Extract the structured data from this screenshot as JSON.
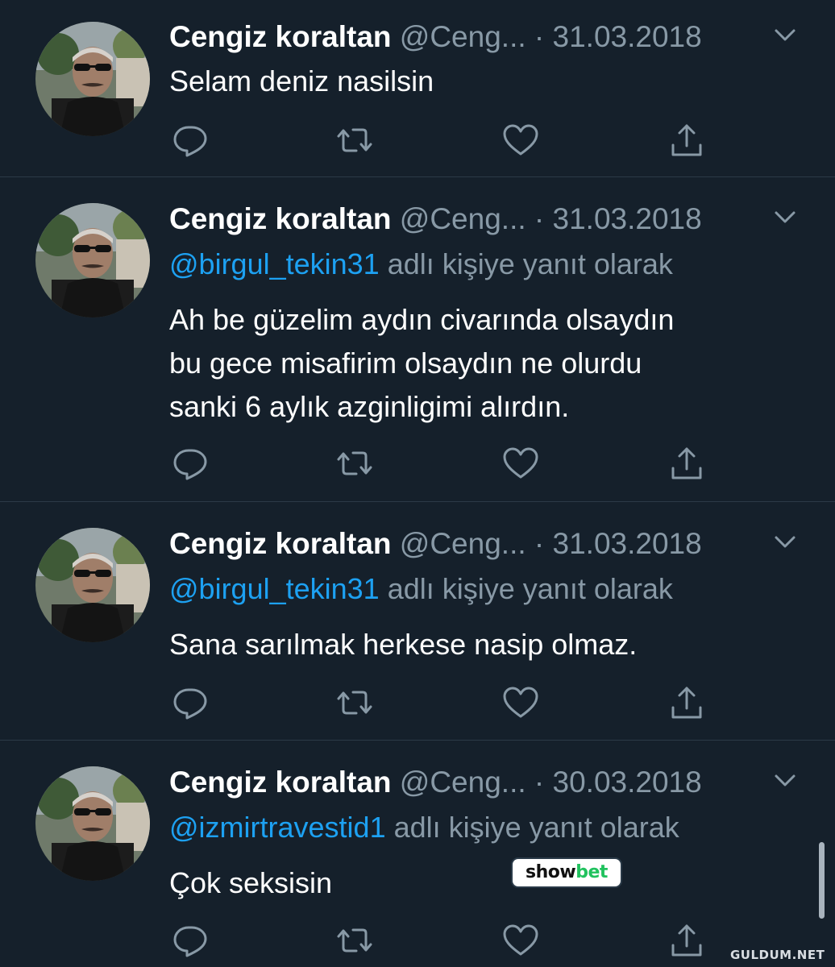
{
  "theme": {
    "background": "#15202b",
    "name_color": "#ffffff",
    "muted_color": "#8899a6",
    "link_color": "#1da1f2",
    "divider_color": "#2c3a47"
  },
  "tweets": [
    {
      "name": "Cengiz koraltan",
      "handle": "@Ceng...",
      "separator": "·",
      "date": "31.03.2018",
      "reply_to": "",
      "reply_suffix": "",
      "text": "Selam deniz nasilsin"
    },
    {
      "name": "Cengiz koraltan",
      "handle": "@Ceng...",
      "separator": "·",
      "date": "31.03.2018",
      "reply_to": "@birgul_tekin31",
      "reply_suffix": "adlı kişiye yanıt olarak",
      "text": "Ah be güzelim aydın civarında olsaydın\nbu gece misafirim olsaydın ne olurdu\nsanki 6 aylık azginligimi alırdın."
    },
    {
      "name": "Cengiz koraltan",
      "handle": "@Ceng...",
      "separator": "·",
      "date": "31.03.2018",
      "reply_to": "@birgul_tekin31",
      "reply_suffix": "adlı kişiye yanıt olarak",
      "text": "Sana sarılmak herkese nasip olmaz."
    },
    {
      "name": "Cengiz koraltan",
      "handle": "@Ceng...",
      "separator": "·",
      "date": "30.03.2018",
      "reply_to": "@izmirtravestid1",
      "reply_suffix": "adlı kişiye yanıt olarak",
      "text": "Çok seksisin"
    }
  ],
  "actions": [
    "reply-icon",
    "retweet-icon",
    "like-icon",
    "share-icon"
  ],
  "overlay_badge": {
    "part1": "show",
    "part2": "bet"
  },
  "watermark": "GULDUM.NET"
}
